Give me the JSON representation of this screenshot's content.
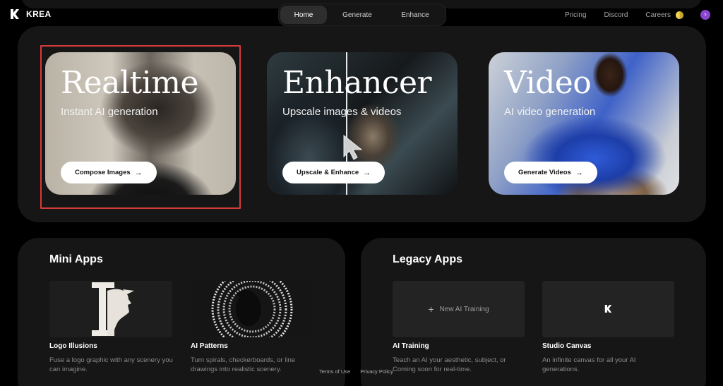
{
  "brand": {
    "name": "KREA",
    "logo_icon": "krea-logo-icon"
  },
  "nav": {
    "tabs": [
      {
        "label": "Home",
        "active": true
      },
      {
        "label": "Generate",
        "active": false
      },
      {
        "label": "Enhance",
        "active": false
      }
    ],
    "links": [
      "Pricing",
      "Discord",
      "Careers"
    ],
    "theme_icon": "theme-toggle-icon",
    "avatar_initial": "s"
  },
  "hero": {
    "cards": [
      {
        "title": "Realtime",
        "subtitle": "Instant AI generation",
        "button": "Compose Images"
      },
      {
        "title": "Enhancer",
        "subtitle": "Upscale images & videos",
        "button": "Upscale & Enhance"
      },
      {
        "title": "Video",
        "subtitle": "AI video generation",
        "button": "Generate Videos"
      }
    ]
  },
  "mini_apps": {
    "title": "Mini Apps",
    "items": [
      {
        "label": "Logo Illusions",
        "desc": "Fuse a logo graphic with any scenery you can imagine."
      },
      {
        "label": "AI Patterns",
        "desc": "Turn spirals, checkerboards, or line drawings into realistic scenery."
      }
    ]
  },
  "legacy_apps": {
    "title": "Legacy Apps",
    "new_training_label": "New AI Training",
    "items": [
      {
        "label": "AI Training",
        "desc": "Teach an AI your aesthetic, subject, or Coming soon for real-time."
      },
      {
        "label": "Studio Canvas",
        "desc": "An infinite canvas for all your AI generations."
      }
    ]
  },
  "footer": {
    "terms": "Terms of Use",
    "privacy": "Privacy Policy"
  },
  "colors": {
    "accent_highlight": "#d73a3a",
    "panel_bg": "#161616",
    "avatar": "#8b46d1"
  }
}
